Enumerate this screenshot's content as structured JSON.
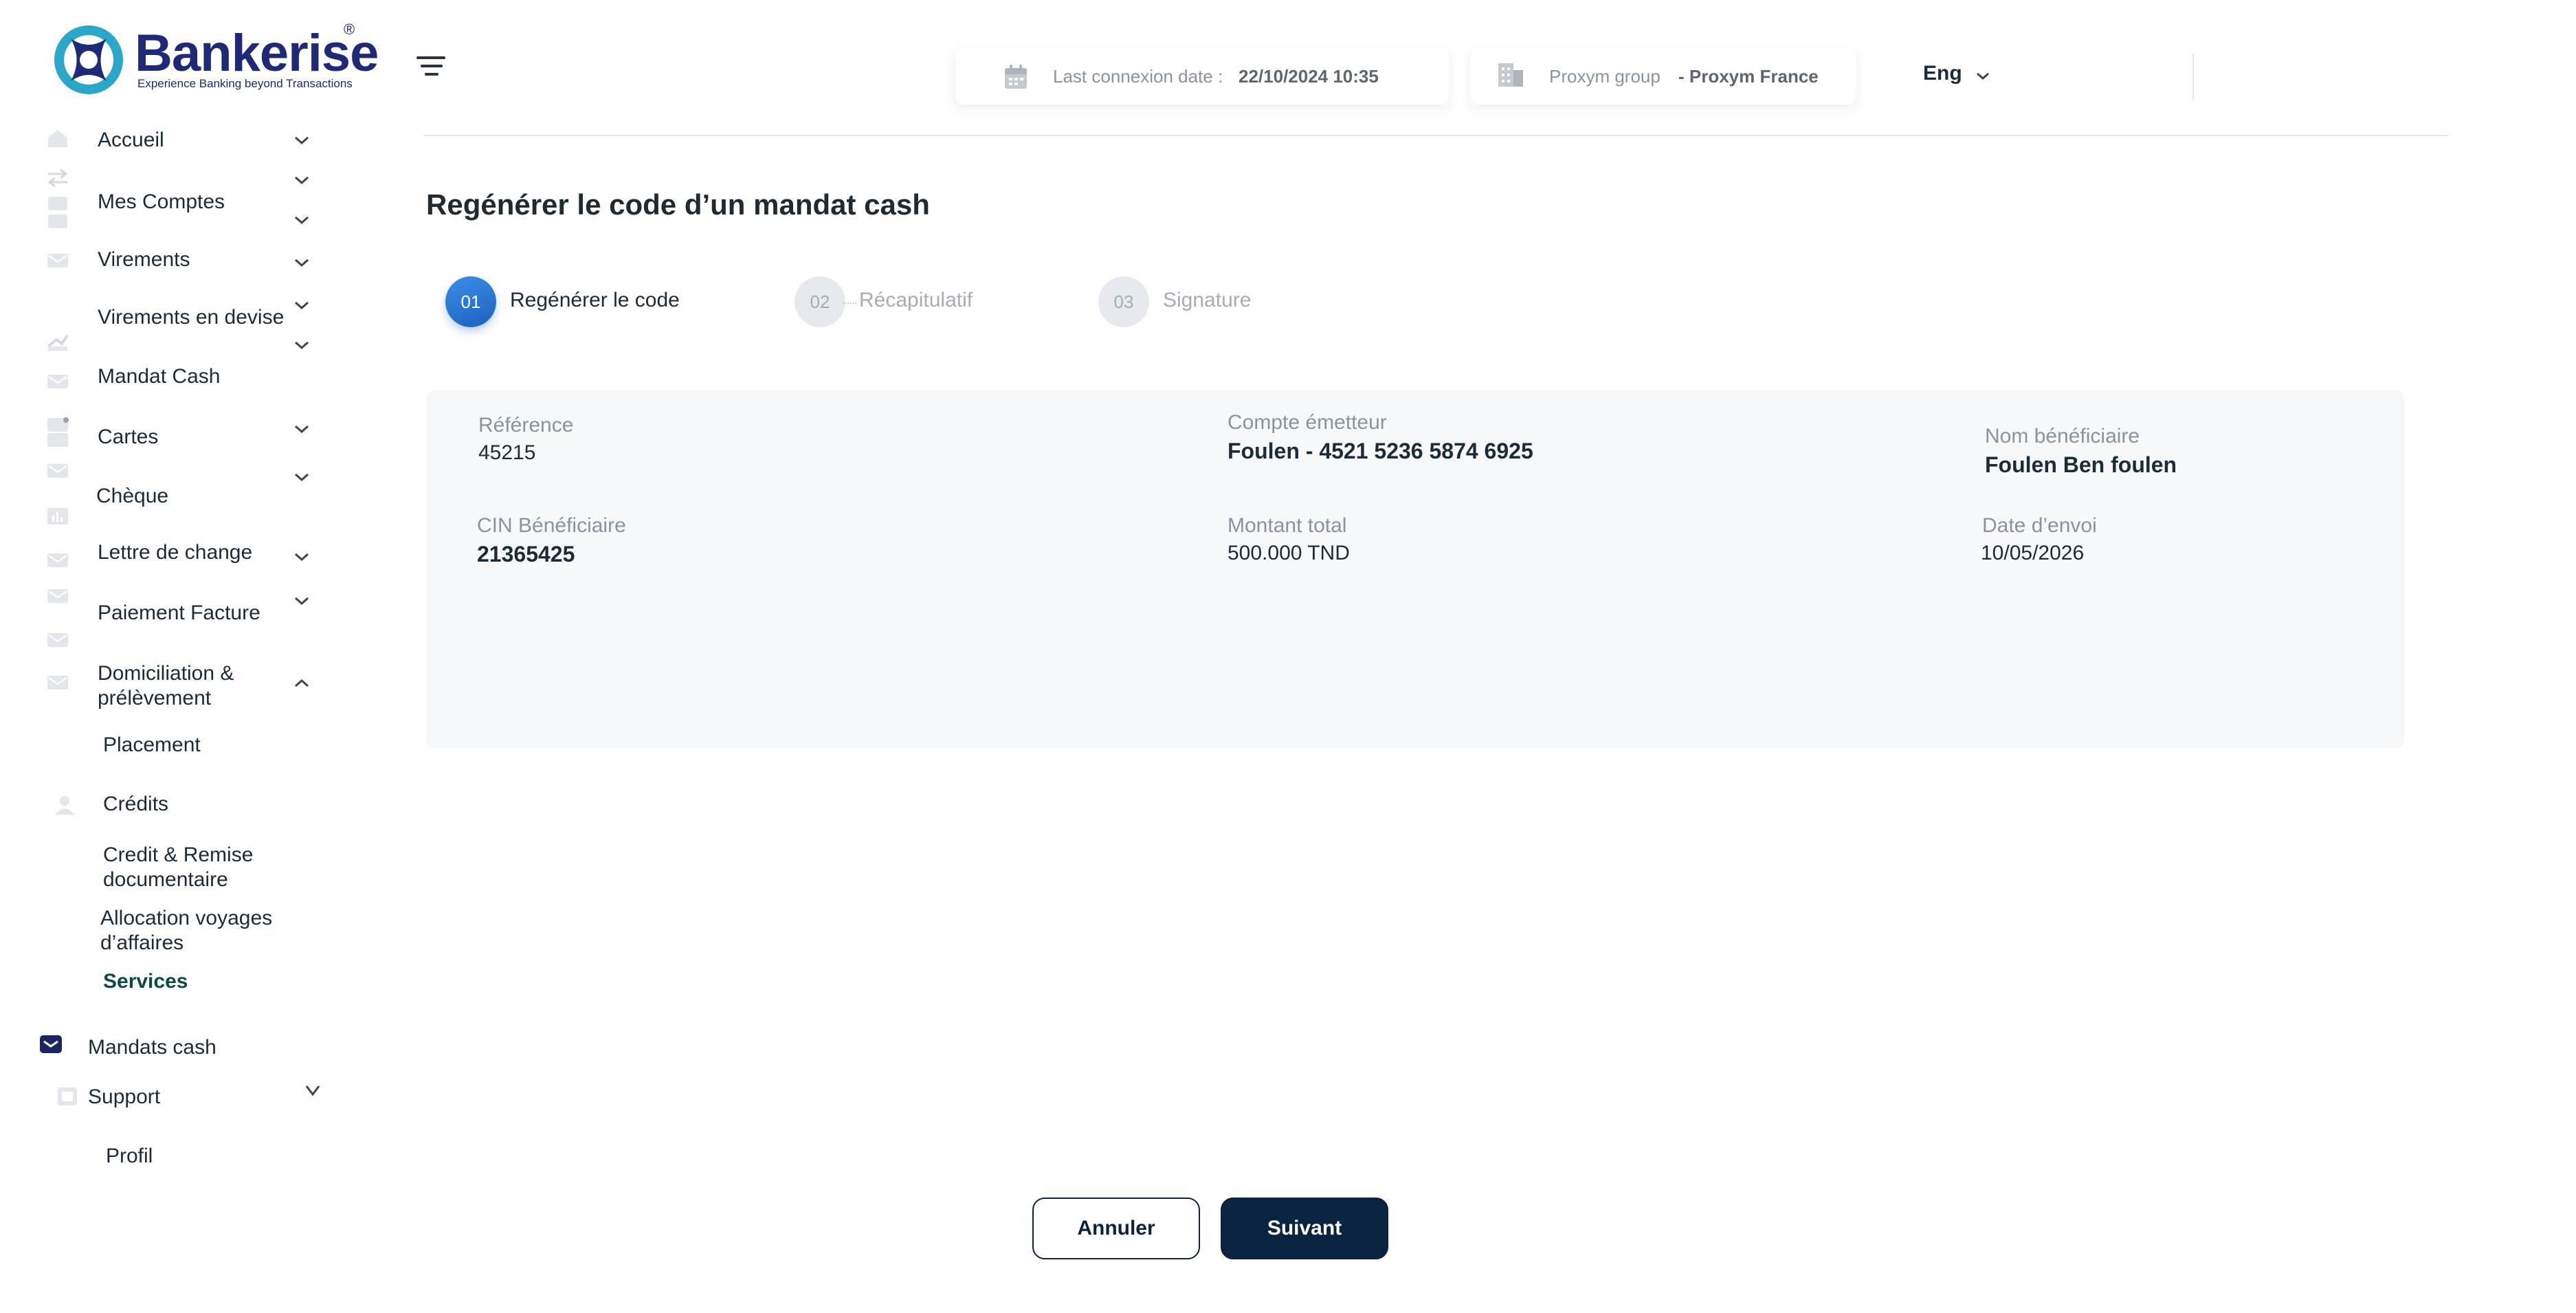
{
  "brand": {
    "name_prefix": "Bank",
    "name_suffix": "erise",
    "tagline": "Experience Banking beyond Transactions",
    "registered": "®",
    "color": "#1e2a78",
    "accent": "#2aa7c9"
  },
  "sidebar": {
    "items": [
      {
        "label": "Accueil",
        "icon": "home-icon"
      },
      {
        "label": "Mes Comptes",
        "icon": "wallet-icon"
      },
      {
        "label": "Virements",
        "icon": "mail-icon"
      },
      {
        "label": "Virements en devise",
        "icon": "exchange-icon"
      },
      {
        "label": "Mandat Cash",
        "icon": "mail-icon"
      },
      {
        "label": "Cartes",
        "icon": "card-icon"
      },
      {
        "label": "Chèque",
        "icon": "mail-icon"
      },
      {
        "label": "Lettre de change",
        "icon": "mail-icon"
      },
      {
        "label": "Paiement Facture",
        "icon": "mail-icon"
      },
      {
        "label_line1": "Domiciliation &",
        "label_line2": "prélèvement",
        "icon": "mail-icon"
      },
      {
        "label": "Placement"
      },
      {
        "label": "Crédits",
        "icon": "user-icon"
      },
      {
        "label_line1": "Credit & Remise",
        "label_line2": "documentaire"
      },
      {
        "label_line1": "Allocation  voyages",
        "label_line2": "d’affaires"
      },
      {
        "label": "Services",
        "active": true
      },
      {
        "label": "Mandats cash",
        "icon": "mail-filled-icon"
      },
      {
        "label": "Support",
        "icon": "support-icon"
      },
      {
        "label": "Profil"
      }
    ]
  },
  "header": {
    "last_connexion_label": "Last connexion date :",
    "last_connexion_value": "22/10/2024 10:35",
    "group_label": "Proxym group",
    "group_value": "- Proxym France",
    "language": "Eng"
  },
  "page": {
    "title": "Regénérer le code d’un mandat cash",
    "steps": [
      {
        "number": "01",
        "label": "Regénérer le code",
        "active": true
      },
      {
        "number": "02",
        "label": "Récapitulatif",
        "active": false
      },
      {
        "number": "03",
        "label": "Signature",
        "active": false
      }
    ],
    "fields": {
      "reference": {
        "label": "Référence",
        "value": "45215"
      },
      "compte": {
        "label": "Compte émetteur",
        "value": "Foulen - 4521 5236 5874 6925"
      },
      "beneficiaire": {
        "label": "Nom bénéficiaire",
        "value": "Foulen Ben foulen"
      },
      "cin": {
        "label": "CIN Bénéficiaire",
        "value": "21365425"
      },
      "montant": {
        "label": "Montant total",
        "value": "500.000 TND"
      },
      "date": {
        "label": "Date d’envoi",
        "value": "10/05/2026"
      }
    },
    "buttons": {
      "cancel": "Annuler",
      "next": "Suivant"
    }
  },
  "colors": {
    "primary_dark": "#0a2340",
    "step_active": "#2b78d6",
    "active_nav": "#0b4a48",
    "panel_bg": "#f7f8fa"
  }
}
